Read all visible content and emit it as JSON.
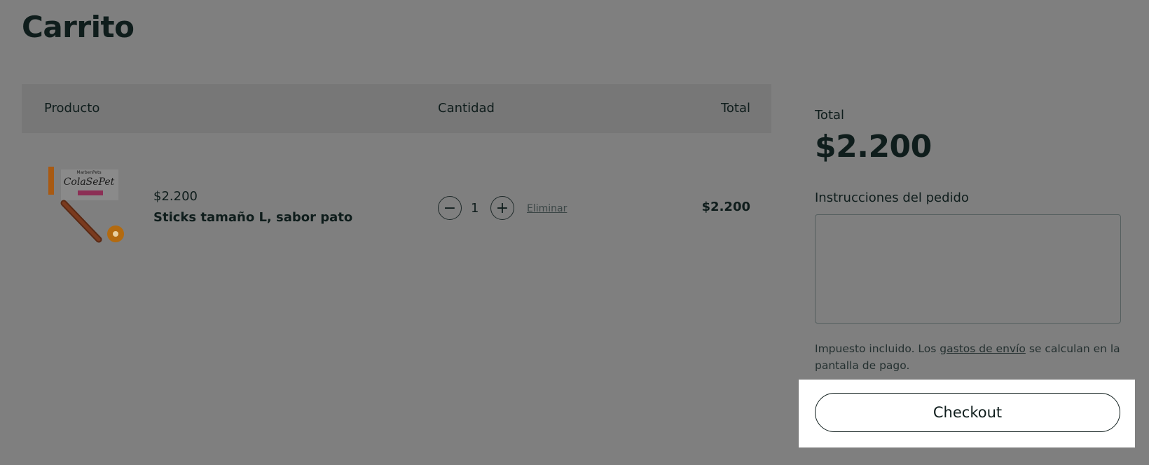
{
  "page": {
    "title": "Carrito"
  },
  "table": {
    "headers": {
      "product": "Producto",
      "quantity": "Cantidad",
      "total": "Total"
    },
    "items": [
      {
        "price": "$2.200",
        "name": "Sticks tamaño L, sabor pato",
        "quantity": "1",
        "minus_symbol": "−",
        "plus_symbol": "+",
        "remove_label": "Eliminar",
        "line_total": "$2.200",
        "image_icon": "product-image"
      }
    ]
  },
  "summary": {
    "total_label": "Total",
    "total_value": "$2.200",
    "notes_label": "Instrucciones del pedido",
    "notes_value": "",
    "tax_text_before": "Impuesto incluido. Los ",
    "tax_link": "gastos de envío",
    "tax_text_after": " se calculan en la pantalla de pago.",
    "checkout_label": "Checkout"
  },
  "colors": {
    "overlay_bg": "#7f7f7f",
    "text": "#0f1d1c",
    "highlight": "#ffffff"
  }
}
